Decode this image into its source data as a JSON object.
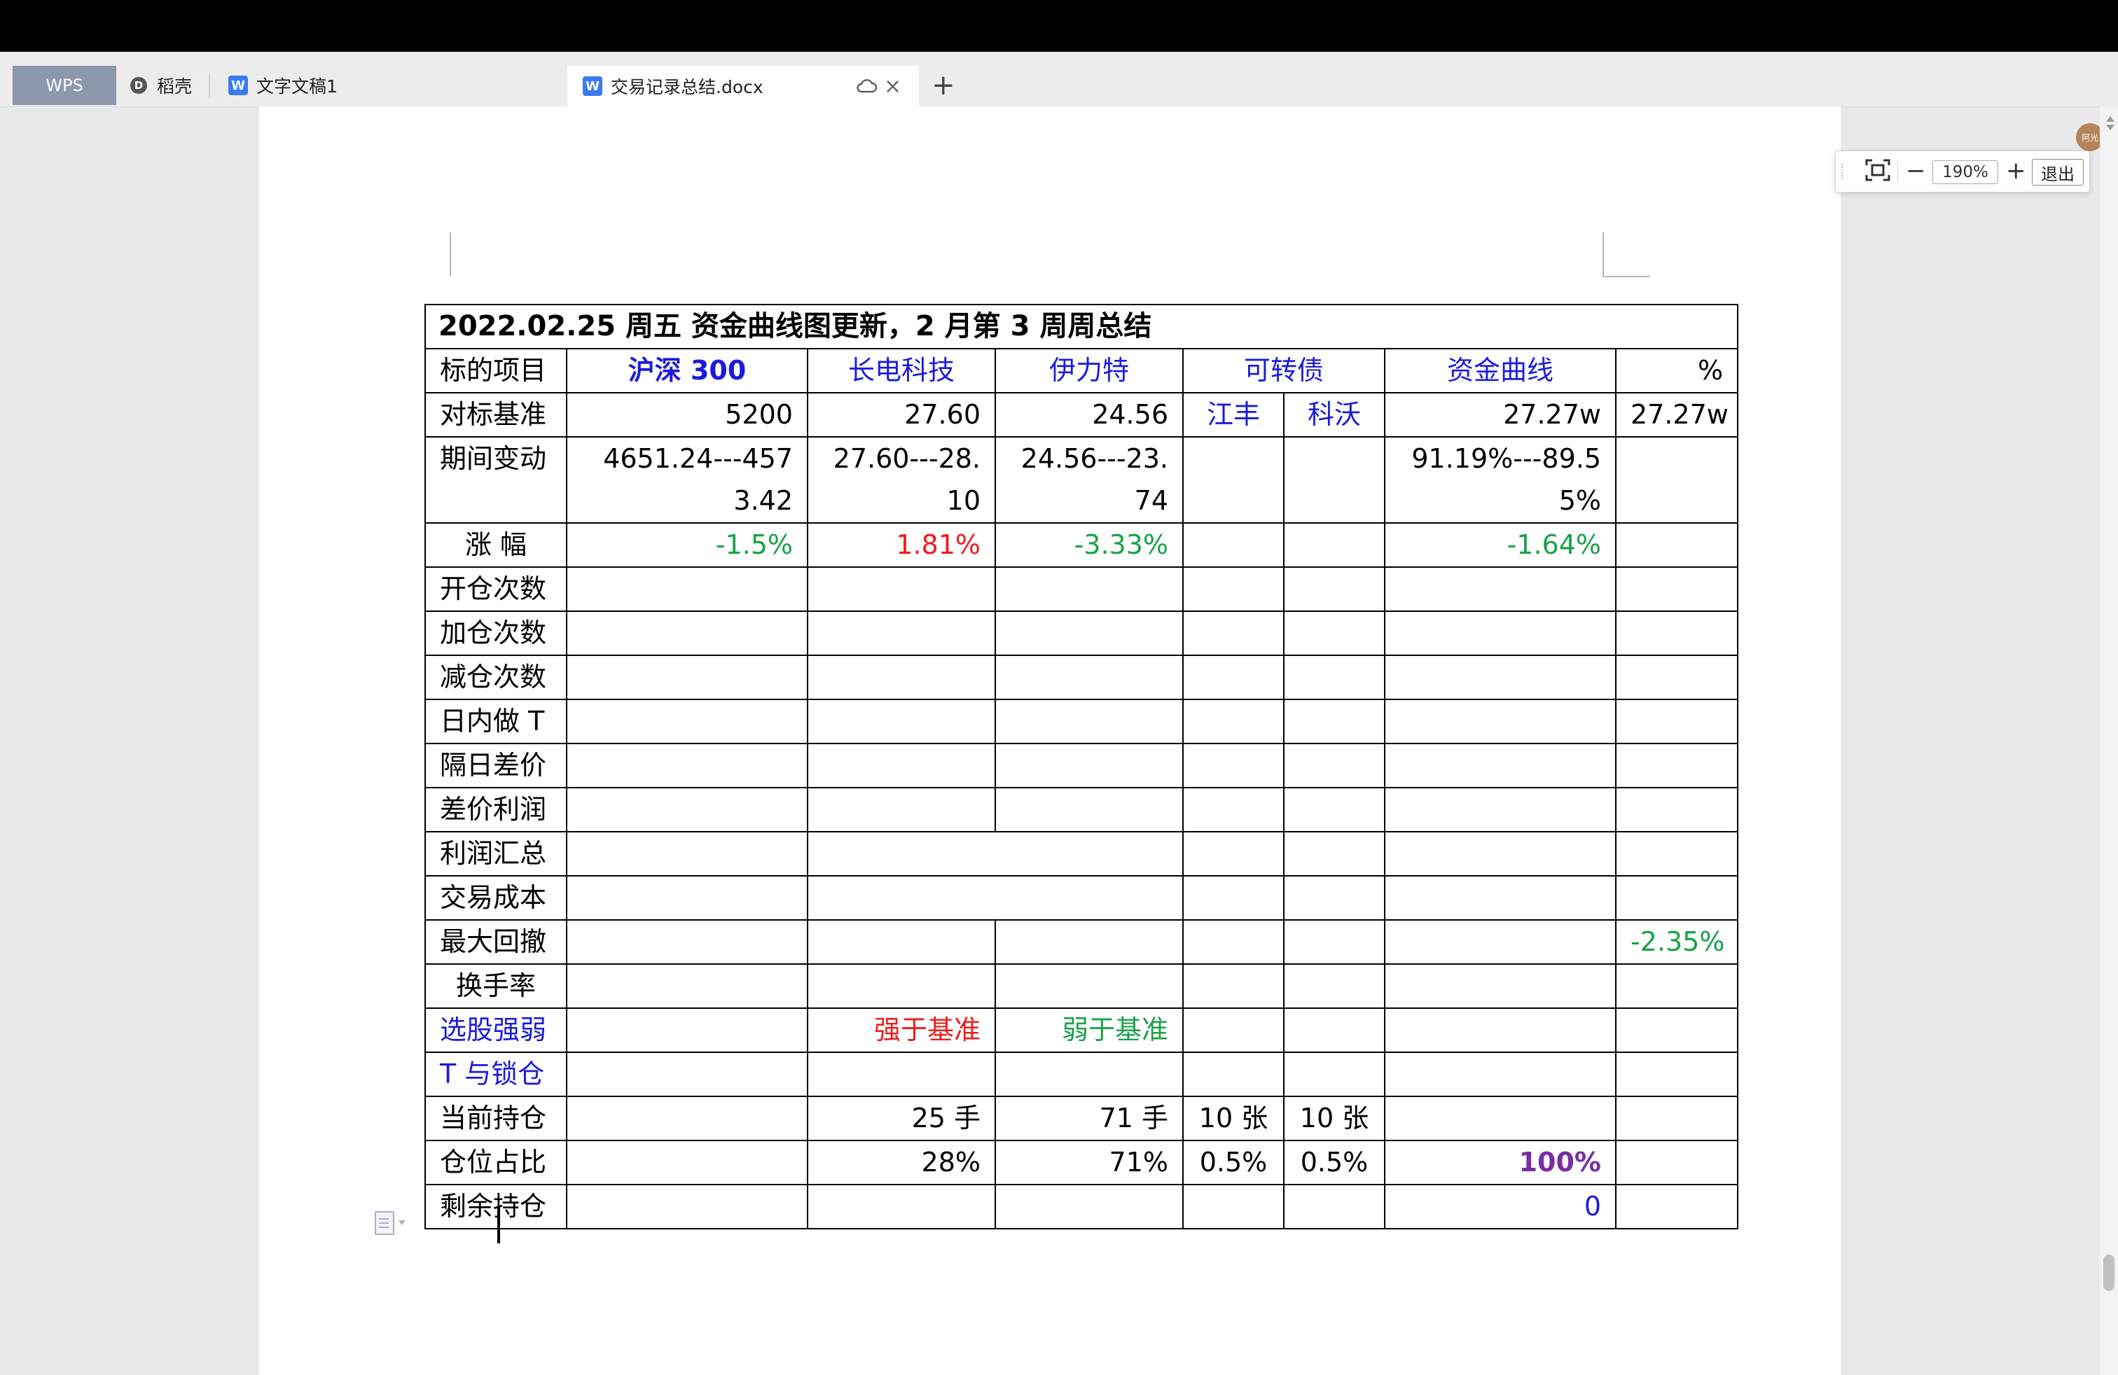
{
  "window": {
    "top_bar": ""
  },
  "tabs": {
    "wps_label": "WPS",
    "daoke_label": "稻壳",
    "doc1_label": "文字文稿1",
    "active_label": "交易记录总结.docx",
    "add_label": "+",
    "close_label": "×",
    "avatar_label": "阿光"
  },
  "zoom": {
    "minus": "−",
    "value": "190%",
    "plus": "+",
    "exit": "退出"
  },
  "table": {
    "title": "2022.02.25  周五  资金曲线图更新，2 月第 3 周周总结",
    "header": {
      "label": "标的项目",
      "col1": "沪深 300",
      "col2": "长电科技",
      "col3": "伊力特",
      "col4": "可转债",
      "col5": "资金曲线",
      "col6": "%"
    },
    "benchmark": {
      "label": "对标基准",
      "col1": "5200",
      "col2": "27.60",
      "col3": "24.56",
      "col4a": "江丰",
      "col4b": "科沃",
      "col5": "27.27w",
      "col6": "27.27w"
    },
    "change": {
      "label": "期间变动",
      "col1": "4651.24---4573.42",
      "col2": "27.60---28.10",
      "col3": "24.56---23.74",
      "col5": "91.19%---89.55%"
    },
    "rise": {
      "label": "涨  幅",
      "col1": "-1.5%",
      "col2": "1.81%",
      "col3": "-3.33%",
      "col5": "-1.64%"
    },
    "rows_plain": {
      "open": "开仓次数",
      "add": "加仓次数",
      "reduce": "减仓次数",
      "intraday": "日内做 T",
      "overnight": "隔日差价",
      "spread_profit": "差价利润",
      "profit_total": "利润汇总",
      "trade_cost": "交易成本"
    },
    "drawdown": {
      "label": "最大回撤",
      "col6": "-2.35%"
    },
    "turnover": {
      "label": "换手率"
    },
    "pick": {
      "label": "选股强弱",
      "col2": "强于基准",
      "col3": "弱于基准"
    },
    "lock": {
      "label": "T 与锁仓"
    },
    "position": {
      "label": "当前持仓",
      "col2": "25 手",
      "col3": "71 手",
      "col4a": "10 张",
      "col4b": "10 张"
    },
    "ratio": {
      "label": "仓位占比",
      "col2": "28%",
      "col3": "71%",
      "col4a": "0.5%",
      "col4b": "0.5%",
      "col5": "100%"
    },
    "remaining": {
      "label": "剩余持仓",
      "col5": "0"
    }
  },
  "colors": {
    "blue": "#1b1bdc",
    "green": "#1aa24a",
    "red": "#ee1c1c",
    "purple": "#7a2ea5",
    "wps_tab": "#8d98ad"
  },
  "icons": [
    "daoke-icon",
    "doc-icon",
    "cloud-icon",
    "close-icon",
    "fit-screen-icon",
    "paragraph-icon"
  ]
}
